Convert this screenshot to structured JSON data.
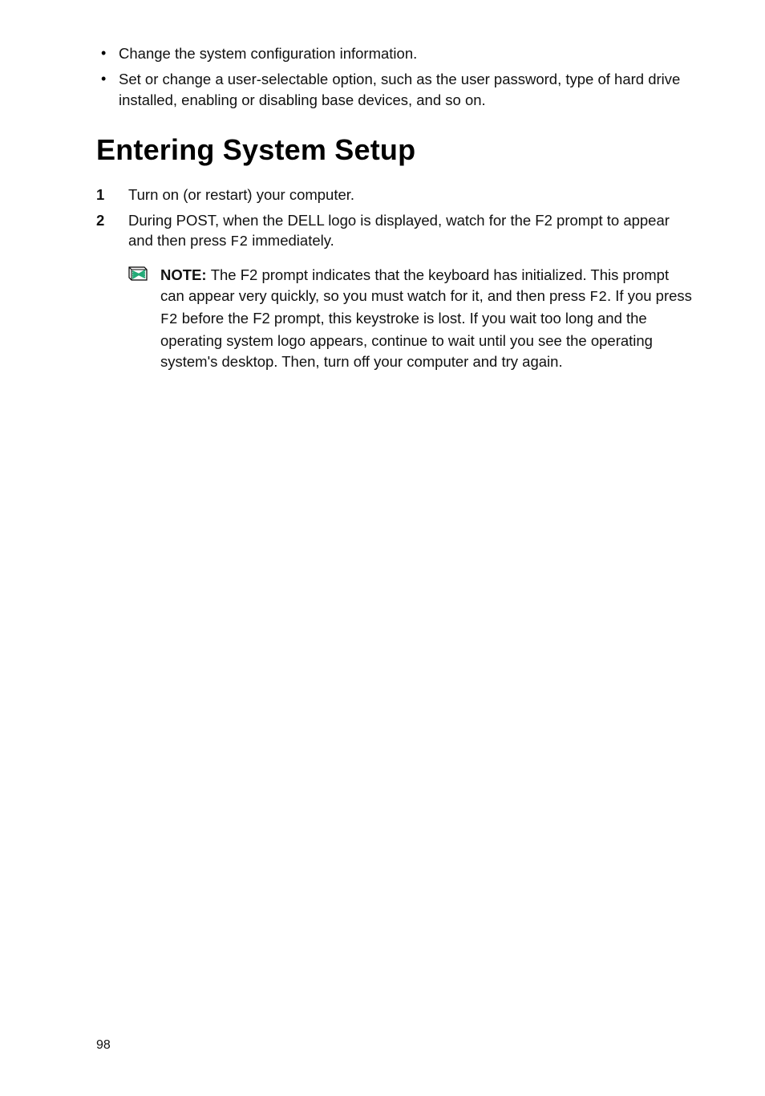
{
  "intro_bullets": [
    "Change the system configuration information.",
    "Set or change a user-selectable option, such as the user password, type of hard drive installed, enabling or disabling base devices, and so on."
  ],
  "heading": "Entering System Setup",
  "steps": {
    "item1": {
      "num": "1",
      "text": "Turn on (or restart) your computer."
    },
    "item2": {
      "num": "2",
      "text_before_mono": "During POST, when the DELL logo is displayed, watch for the F2 prompt to appear and then press ",
      "mono": "F2",
      "text_after_mono": " immediately."
    }
  },
  "note": {
    "label": "NOTE: ",
    "part1": "The F2 prompt indicates that the keyboard has initialized. This prompt can appear very quickly, so you must watch for it, and then press ",
    "mono1": "F2",
    "part2": ". If you press ",
    "mono2": "F2",
    "part3": " before the F2 prompt, this keystroke is lost. If you wait too long and the operating system logo appears, continue to wait until you see the operating system's desktop. Then, turn off your computer and try again."
  },
  "page_number": "98"
}
